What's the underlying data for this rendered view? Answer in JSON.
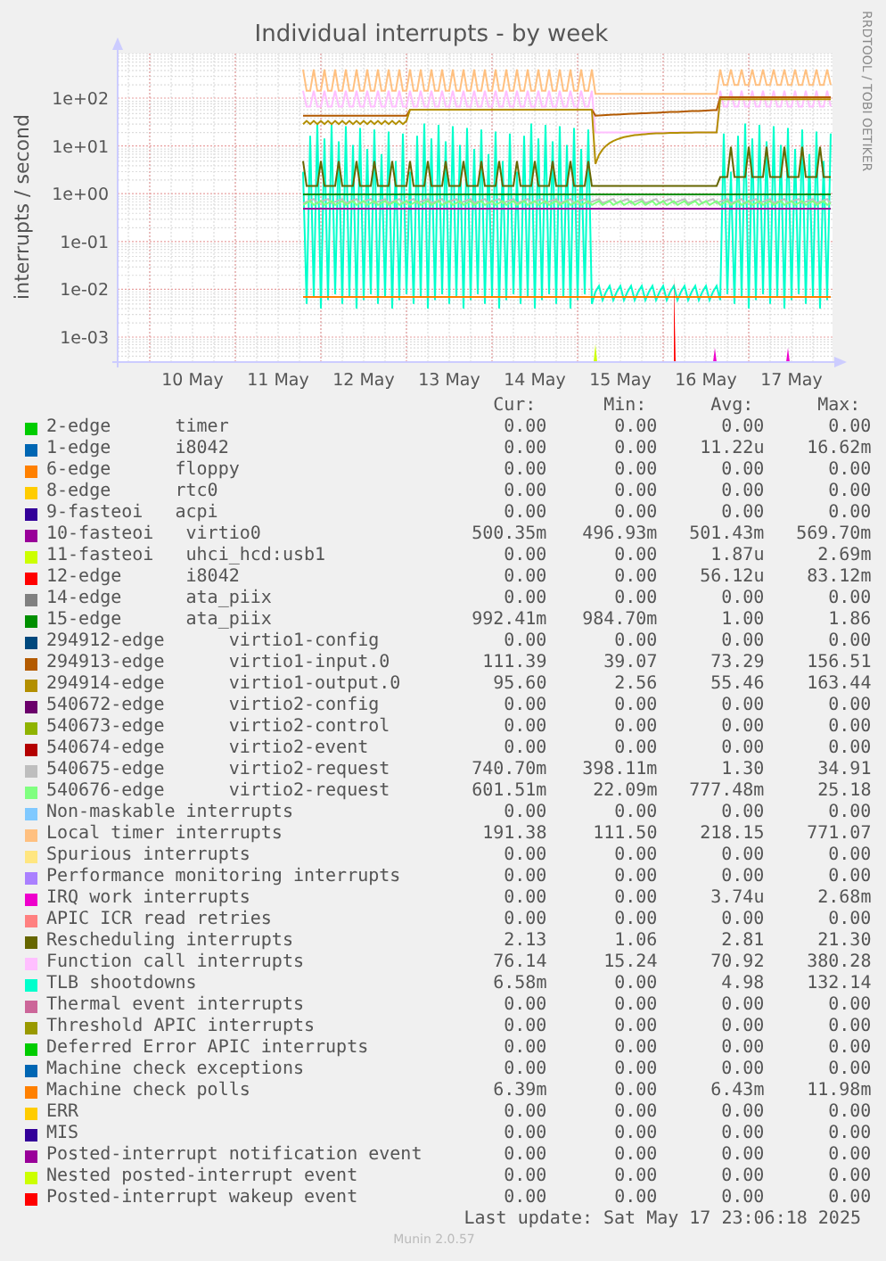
{
  "chart": {
    "title": "Individual interrupts - by week",
    "y_axis_label": "interrupts / second",
    "side_credit": "RRDTOOL / TOBI OETIKER",
    "y_ticks": [
      "1e+02",
      "1e+01",
      "1e+00",
      "1e-01",
      "1e-02",
      "1e-03"
    ],
    "x_ticks": [
      "10 May",
      "11 May",
      "12 May",
      "13 May",
      "14 May",
      "15 May",
      "16 May",
      "17 May"
    ]
  },
  "legend": {
    "columns": [
      "Cur:",
      "Min:",
      "Avg:",
      "Max:"
    ],
    "rows": [
      {
        "label": "2-edge      timer",
        "color": "#00cc00",
        "cur": "0.00",
        "min": "0.00",
        "avg": "0.00",
        "max": "0.00"
      },
      {
        "label": "1-edge      i8042",
        "color": "#0066b3",
        "cur": "0.00",
        "min": "0.00",
        "avg": "11.22u",
        "max": "16.62m"
      },
      {
        "label": "6-edge      floppy",
        "color": "#ff8000",
        "cur": "0.00",
        "min": "0.00",
        "avg": "0.00",
        "max": "0.00"
      },
      {
        "label": "8-edge      rtc0",
        "color": "#ffcc00",
        "cur": "0.00",
        "min": "0.00",
        "avg": "0.00",
        "max": "0.00"
      },
      {
        "label": "9-fasteoi   acpi",
        "color": "#330099",
        "cur": "0.00",
        "min": "0.00",
        "avg": "0.00",
        "max": "0.00"
      },
      {
        "label": "10-fasteoi   virtio0",
        "color": "#990099",
        "cur": "500.35m",
        "min": "496.93m",
        "avg": "501.43m",
        "max": "569.70m"
      },
      {
        "label": "11-fasteoi   uhci_hcd:usb1",
        "color": "#ccff00",
        "cur": "0.00",
        "min": "0.00",
        "avg": "1.87u",
        "max": "2.69m"
      },
      {
        "label": "12-edge      i8042",
        "color": "#ff0000",
        "cur": "0.00",
        "min": "0.00",
        "avg": "56.12u",
        "max": "83.12m"
      },
      {
        "label": "14-edge      ata_piix",
        "color": "#808080",
        "cur": "0.00",
        "min": "0.00",
        "avg": "0.00",
        "max": "0.00"
      },
      {
        "label": "15-edge      ata_piix",
        "color": "#008f00",
        "cur": "992.41m",
        "min": "984.70m",
        "avg": "1.00",
        "max": "1.86"
      },
      {
        "label": "294912-edge      virtio1-config",
        "color": "#00487d",
        "cur": "0.00",
        "min": "0.00",
        "avg": "0.00",
        "max": "0.00"
      },
      {
        "label": "294913-edge      virtio1-input.0",
        "color": "#b35a00",
        "cur": "111.39",
        "min": "39.07",
        "avg": "73.29",
        "max": "156.51"
      },
      {
        "label": "294914-edge      virtio1-output.0",
        "color": "#b38f00",
        "cur": "95.60",
        "min": "2.56",
        "avg": "55.46",
        "max": "163.44"
      },
      {
        "label": "540672-edge      virtio2-config",
        "color": "#6b006b",
        "cur": "0.00",
        "min": "0.00",
        "avg": "0.00",
        "max": "0.00"
      },
      {
        "label": "540673-edge      virtio2-control",
        "color": "#8fb300",
        "cur": "0.00",
        "min": "0.00",
        "avg": "0.00",
        "max": "0.00"
      },
      {
        "label": "540674-edge      virtio2-event",
        "color": "#b30000",
        "cur": "0.00",
        "min": "0.00",
        "avg": "0.00",
        "max": "0.00"
      },
      {
        "label": "540675-edge      virtio2-request",
        "color": "#bebebe",
        "cur": "740.70m",
        "min": "398.11m",
        "avg": "1.30",
        "max": "34.91"
      },
      {
        "label": "540676-edge      virtio2-request",
        "color": "#80ff80",
        "cur": "601.51m",
        "min": "22.09m",
        "avg": "777.48m",
        "max": "25.18"
      },
      {
        "label": "Non-maskable interrupts",
        "color": "#80c9ff",
        "cur": "0.00",
        "min": "0.00",
        "avg": "0.00",
        "max": "0.00"
      },
      {
        "label": "Local timer interrupts",
        "color": "#ffc080",
        "cur": "191.38",
        "min": "111.50",
        "avg": "218.15",
        "max": "771.07"
      },
      {
        "label": "Spurious interrupts",
        "color": "#ffe680",
        "cur": "0.00",
        "min": "0.00",
        "avg": "0.00",
        "max": "0.00"
      },
      {
        "label": "Performance monitoring interrupts",
        "color": "#aa80ff",
        "cur": "0.00",
        "min": "0.00",
        "avg": "0.00",
        "max": "0.00"
      },
      {
        "label": "IRQ work interrupts",
        "color": "#ee00cc",
        "cur": "0.00",
        "min": "0.00",
        "avg": "3.74u",
        "max": "2.68m"
      },
      {
        "label": "APIC ICR read retries",
        "color": "#ff8080",
        "cur": "0.00",
        "min": "0.00",
        "avg": "0.00",
        "max": "0.00"
      },
      {
        "label": "Rescheduling interrupts",
        "color": "#666600",
        "cur": "2.13",
        "min": "1.06",
        "avg": "2.81",
        "max": "21.30"
      },
      {
        "label": "Function call interrupts",
        "color": "#ffbfff",
        "cur": "76.14",
        "min": "15.24",
        "avg": "70.92",
        "max": "380.28"
      },
      {
        "label": "TLB shootdowns",
        "color": "#00ffcc",
        "cur": "6.58m",
        "min": "0.00",
        "avg": "4.98",
        "max": "132.14"
      },
      {
        "label": "Thermal event interrupts",
        "color": "#cc6699",
        "cur": "0.00",
        "min": "0.00",
        "avg": "0.00",
        "max": "0.00"
      },
      {
        "label": "Threshold APIC interrupts",
        "color": "#999900",
        "cur": "0.00",
        "min": "0.00",
        "avg": "0.00",
        "max": "0.00"
      },
      {
        "label": "Deferred Error APIC interrupts",
        "color": "#00cc00",
        "cur": "0.00",
        "min": "0.00",
        "avg": "0.00",
        "max": "0.00"
      },
      {
        "label": "Machine check exceptions",
        "color": "#0066b3",
        "cur": "0.00",
        "min": "0.00",
        "avg": "0.00",
        "max": "0.00"
      },
      {
        "label": "Machine check polls",
        "color": "#ff8000",
        "cur": "6.39m",
        "min": "0.00",
        "avg": "6.43m",
        "max": "11.98m"
      },
      {
        "label": "ERR",
        "color": "#ffcc00",
        "cur": "0.00",
        "min": "0.00",
        "avg": "0.00",
        "max": "0.00"
      },
      {
        "label": "MIS",
        "color": "#330099",
        "cur": "0.00",
        "min": "0.00",
        "avg": "0.00",
        "max": "0.00"
      },
      {
        "label": "Posted-interrupt notification event",
        "color": "#990099",
        "cur": "0.00",
        "min": "0.00",
        "avg": "0.00",
        "max": "0.00"
      },
      {
        "label": "Nested posted-interrupt event",
        "color": "#ccff00",
        "cur": "0.00",
        "min": "0.00",
        "avg": "0.00",
        "max": "0.00"
      },
      {
        "label": "Posted-interrupt wakeup event",
        "color": "#ff0000",
        "cur": "0.00",
        "min": "0.00",
        "avg": "0.00",
        "max": "0.00"
      }
    ]
  },
  "last_update": "Last update: Sat May 17 23:06:18 2025",
  "version": "Munin 2.0.57"
}
